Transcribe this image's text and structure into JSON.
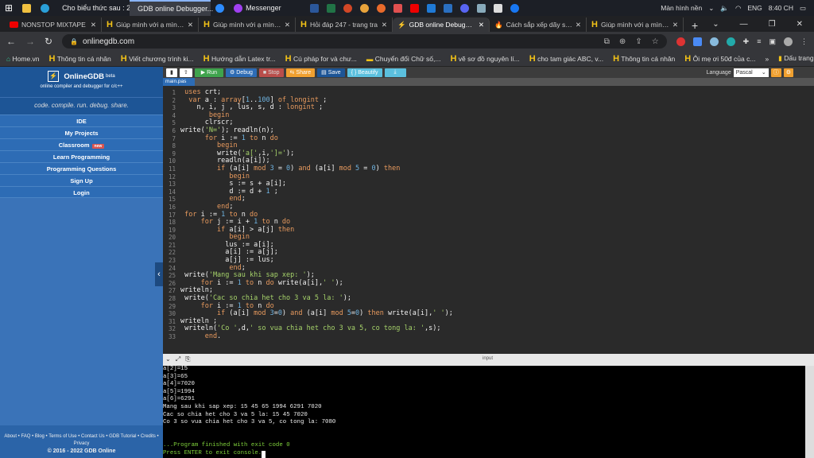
{
  "taskbar": {
    "apps": [
      {
        "label": "Cho biểu thức sau : 2...",
        "active": false
      },
      {
        "label": "GDB online Debugger...",
        "active": true
      },
      {
        "label": "",
        "active": false
      },
      {
        "label": "Messenger",
        "active": false
      }
    ],
    "tray": {
      "desktop": "Màn hình nền",
      "lang": "ENG",
      "time": "8:40 CH"
    }
  },
  "tabs": [
    {
      "label": "NONSTOP MIXTAPE",
      "icon": "youtube"
    },
    {
      "label": "Giúp mình với ạ mình c",
      "icon": "h"
    },
    {
      "label": "Giúp mình với ạ mình c",
      "icon": "h"
    },
    {
      "label": "Hỏi đáp 247 - trang tra",
      "icon": "h"
    },
    {
      "label": "GDB online Debugger |",
      "icon": "gdb",
      "active": true
    },
    {
      "label": "Cách sắp xếp dãy số tă",
      "icon": "fire"
    },
    {
      "label": "Giúp mình với ạ mình c",
      "icon": "h"
    }
  ],
  "address": {
    "url": "onlinegdb.com"
  },
  "bookmarks": [
    "Home.vn",
    "Thông tin cá nhân",
    "Viết chương trình ki...",
    "Hướng dẫn Latex tr...",
    "Cú pháp for và chư...",
    "Chuyển đổi Chữ số,...",
    "vẽ sơ đồ nguyên lí...",
    "cho tam giác ABC, v...",
    "Thông tin cá nhân",
    "Ôi mẹ ơi 50đ của c..."
  ],
  "bookmarks_other": "Dấu trang khác",
  "sidebar": {
    "brand": "OnlineGDB",
    "beta": "beta",
    "subtitle": "online compiler and debugger for c/c++",
    "tagline": "code. compile. run. debug. share.",
    "items": [
      "IDE",
      "My Projects",
      "Classroom",
      "Learn Programming",
      "Programming Questions",
      "Sign Up",
      "Login"
    ],
    "new_badge": "new",
    "footer_links": "About • FAQ • Blog • Terms of Use • Contact Us • GDB Tutorial • Credits • Privacy",
    "copyright": "© 2016 - 2022 GDB Online"
  },
  "toolbar": {
    "run": "Run",
    "debug": "Debug",
    "stop": "Stop",
    "share": "Share",
    "save": "Save",
    "beautify": "{ } Beautify",
    "language_label": "Language",
    "language": "Pascal"
  },
  "file_tab": "main.pas",
  "code": [
    " uses crt;",
    "  var a : array[1..100] of longint ;",
    "    n, i, j , lus, s, d : longint ;",
    "       begin",
    "      clrscr;",
    "write('N='); readln(n);",
    "      for i := 1 to n do",
    "         begin",
    "         write('a[',i,']=');",
    "         readln(a[i]);",
    "         if (a[i] mod 3 = 0) and (a[i] mod 5 = 0) then",
    "            begin",
    "            s := s + a[i];",
    "            d := d + 1 ;",
    "            end;",
    "         end;",
    " for i := 1 to n do",
    "     for j := i + 1 to n do",
    "         if a[i] > a[j] then",
    "            begin",
    "           lus := a[i];",
    "           a[i] := a[j];",
    "           a[j] := lus;",
    "            end;",
    " write('Mang sau khi sap xep: ');",
    "     for i := 1 to n do write(a[i],' ');",
    "writeln;",
    " write('Cac so chia het cho 3 va 5 la: ');",
    "     for i := 1 to n do",
    "         if (a[i] mod 3=0) and (a[i] mod 5=0) then write(a[i],' ');",
    "writeln ;",
    " writeln('Co ',d,' so vua chia het cho 3 va 5, co tong la: ',s);",
    "      end."
  ],
  "console": {
    "header": "input",
    "lines": [
      "a[2]=15",
      "a[3]=65",
      "a[4]=7020",
      "a[5]=1994",
      "a[6]=6291",
      "Mang sau khi sap xep: 15 45 65 1994 6291 7020",
      "Cac so chia het cho 3 va 5 la: 15 45 7020",
      "Co 3 so vua chia het cho 3 va 5, co tong la: 7080",
      "",
      ""
    ],
    "finish": [
      "...Program finished with exit code 0",
      "Press ENTER to exit console."
    ]
  },
  "colors": {
    "sidebar": "#2d6cb5",
    "run": "#3fa34d",
    "debug": "#2d6cb5",
    "stop": "#d9534f",
    "share": "#f0a030",
    "save": "#1d5596",
    "beautify": "#5bc0de",
    "keyword": "#e0894b",
    "string": "#9ec75b",
    "number": "#5fa6d6"
  }
}
